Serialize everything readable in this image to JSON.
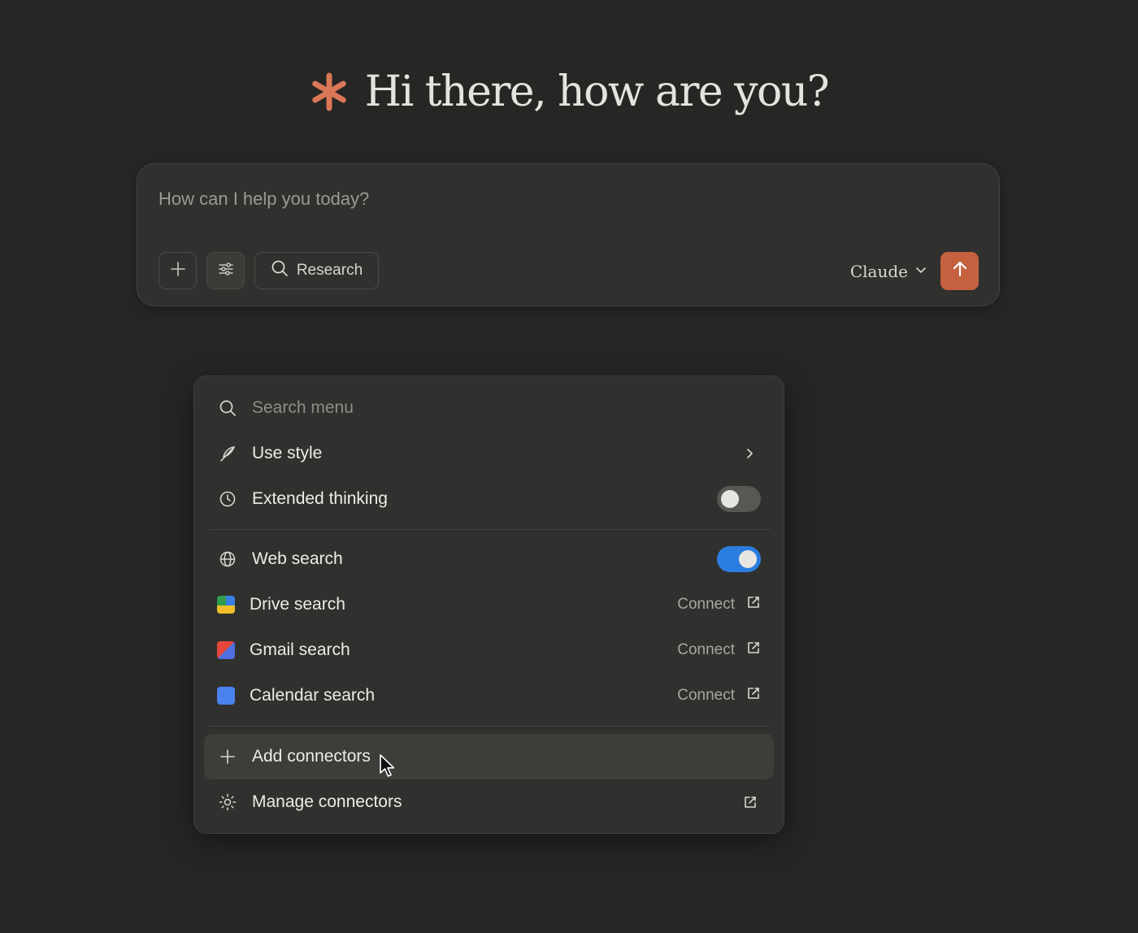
{
  "greeting": {
    "logo_icon": "claude-asterisk-icon",
    "logo_color": "#d97757",
    "title": "Hi there, how are you?"
  },
  "composer": {
    "placeholder": "How can I help you today?",
    "value": "",
    "buttons": {
      "attach_icon": "plus-icon",
      "tools_icon": "sliders-icon",
      "research_label": "Research",
      "research_icon": "search-icon"
    },
    "model": {
      "label": "Claude",
      "icon": "chevron-down-icon"
    },
    "send": {
      "icon": "arrow-up-icon",
      "color": "#c6613f"
    }
  },
  "menu": {
    "search_placeholder": "Search menu",
    "items": [
      {
        "label": "Use style",
        "icon": "feather-icon",
        "trailing": "chevron-right-icon"
      },
      {
        "label": "Extended thinking",
        "icon": "clock-icon",
        "toggle": false
      },
      {
        "label": "Web search",
        "icon": "globe-icon",
        "toggle": true
      },
      {
        "label": "Drive search",
        "icon": "google-drive-icon",
        "action": "Connect"
      },
      {
        "label": "Gmail search",
        "icon": "gmail-icon",
        "action": "Connect"
      },
      {
        "label": "Calendar search",
        "icon": "google-calendar-icon",
        "action": "Connect"
      },
      {
        "label": "Add connectors",
        "icon": "plus-icon",
        "hovered": true
      },
      {
        "label": "Manage connectors",
        "icon": "settings-sun-icon",
        "trailing": "external-link-icon"
      }
    ],
    "toggle_on_color": "#2b7de0"
  }
}
